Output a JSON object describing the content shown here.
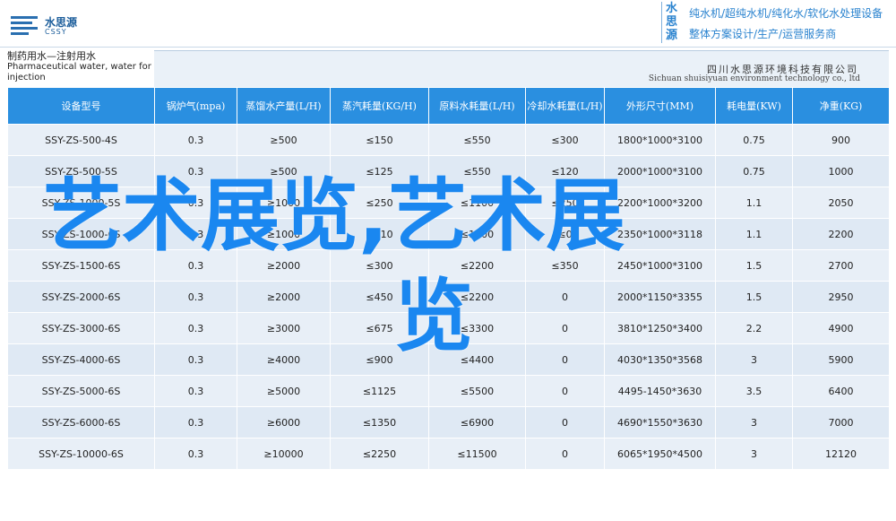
{
  "header": {
    "logo_cn": "水思源",
    "logo_en": "CSSY",
    "slogan_brand": "水思源",
    "slogan_line1": "纯水机/超纯水机/纯化水/软化水处理设备",
    "slogan_line2": "整体方案设计/生产/运营服务商"
  },
  "title": {
    "cn": "制药用水—注射用水",
    "en": "Pharmaceutical water, water for injection"
  },
  "company": {
    "cn": "四川水思源环境科技有限公司",
    "en": "Sichuan shuisiyuan environment technology co., ltd"
  },
  "table": {
    "headers": [
      "设备型号",
      "锅炉气(mpa)",
      "蒸馏水产量(L/H)",
      "蒸汽耗量(KG/H)",
      "原料水耗量(L/H)",
      "冷却水耗量(L/H)",
      "外形尺寸(MM)",
      "耗电量(KW)",
      "净重(KG)"
    ],
    "rows": [
      [
        "SSY-ZS-500-4S",
        "0.3",
        "≥500",
        "≤150",
        "≤550",
        "≤300",
        "1800*1000*3100",
        "0.75",
        "900"
      ],
      [
        "SSY-ZS-500-5S",
        "0.3",
        "≥500",
        "≤125",
        "≤550",
        "≤120",
        "2000*1000*3100",
        "0.75",
        "1000"
      ],
      [
        "SSY-ZS-1000-5S",
        "0.3",
        "≥1000",
        "≤250",
        "≤1100",
        "≤250",
        "2200*1000*3200",
        "1.1",
        "2050"
      ],
      [
        "SSY-ZS-1000-6S",
        "0.3",
        "≥1000",
        "≤210",
        "≤1100",
        "≤0",
        "2350*1000*3118",
        "1.1",
        "2200"
      ],
      [
        "SSY-ZS-1500-6S",
        "0.3",
        "≥2000",
        "≤300",
        "≤2200",
        "≤350",
        "2450*1000*3100",
        "1.5",
        "2700"
      ],
      [
        "SSY-ZS-2000-6S",
        "0.3",
        "≥2000",
        "≤450",
        "≤2200",
        "0",
        "2000*1150*3355",
        "1.5",
        "2950"
      ],
      [
        "SSY-ZS-3000-6S",
        "0.3",
        "≥3000",
        "≤675",
        "≤3300",
        "0",
        "3810*1250*3400",
        "2.2",
        "4900"
      ],
      [
        "SSY-ZS-4000-6S",
        "0.3",
        "≥4000",
        "≤900",
        "≤4400",
        "0",
        "4030*1350*3568",
        "3",
        "5900"
      ],
      [
        "SSY-ZS-5000-6S",
        "0.3",
        "≥5000",
        "≤1125",
        "≤5500",
        "0",
        "4495-1450*3630",
        "3.5",
        "6400"
      ],
      [
        "SSY-ZS-6000-6S",
        "0.3",
        "≥6000",
        "≤1350",
        "≤6900",
        "0",
        "4690*1550*3630",
        "3",
        "7000"
      ],
      [
        "SSY-ZS-10000-6S",
        "0.3",
        "≥10000",
        "≤2250",
        "≤11500",
        "0",
        "6065*1950*4500",
        "3",
        "12120"
      ]
    ]
  },
  "watermark": {
    "line1": "艺术展览,艺术展",
    "line2": "览"
  }
}
